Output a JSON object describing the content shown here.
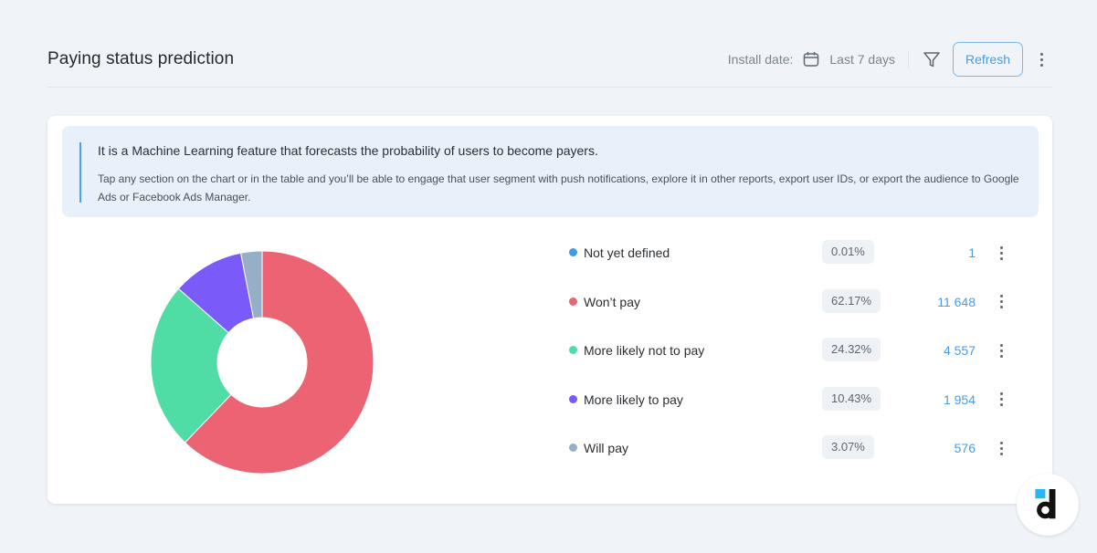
{
  "header": {
    "title": "Paying status prediction",
    "install_label": "Install date:",
    "date_value": "Last 7 days",
    "refresh_label": "Refresh",
    "icons": {
      "calendar": "calendar-icon",
      "filter": "filter-icon",
      "more": "more-vertical-icon"
    }
  },
  "info": {
    "title": "It is a Machine Learning feature that forecasts the probability of users to become payers.",
    "body": "Tap any section on the chart or in the table and you’ll be able to engage that user segment with push notifications, explore it in other reports, export user IDs, or export the audience to Google Ads or Facebook Ads Manager."
  },
  "segments": [
    {
      "label": "Not yet defined",
      "percent": "0.01%",
      "count": "1",
      "color": "#3d9be9"
    },
    {
      "label": "Won’t pay",
      "percent": "62.17%",
      "count": "11 648",
      "color": "#ec6374"
    },
    {
      "label": "More likely not to pay",
      "percent": "24.32%",
      "count": "4 557",
      "color": "#50dca5"
    },
    {
      "label": "More likely to pay",
      "percent": "10.43%",
      "count": "1 954",
      "color": "#7a5af8"
    },
    {
      "label": "Will pay",
      "percent": "3.07%",
      "count": "576",
      "color": "#94afc6"
    }
  ],
  "chart_data": {
    "type": "pie",
    "variant": "donut",
    "title": "Paying status prediction",
    "categories": [
      "Not yet defined",
      "Won’t pay",
      "More likely not to pay",
      "More likely to pay",
      "Will pay"
    ],
    "values": [
      1,
      11648,
      4557,
      1954,
      576
    ],
    "percentages": [
      0.01,
      62.17,
      24.32,
      10.43,
      3.07
    ],
    "colors": [
      "#3d9be9",
      "#ec6374",
      "#50dca5",
      "#7a5af8",
      "#94afc6"
    ],
    "legend": "right",
    "start_angle": "top, clockwise"
  },
  "logo": {
    "name": "devtodev-logo"
  }
}
